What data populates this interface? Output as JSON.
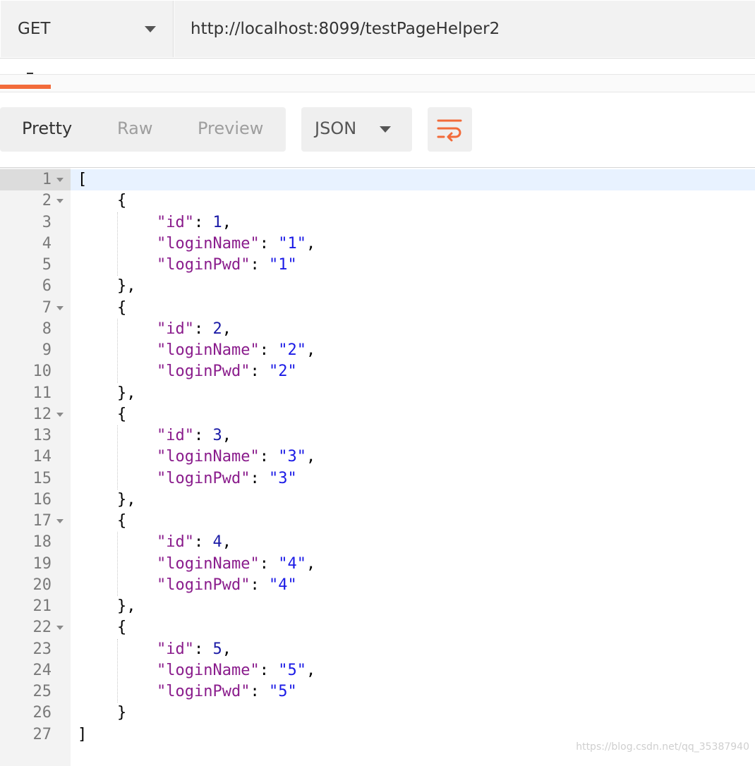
{
  "request": {
    "method": "GET",
    "url": "http://localhost:8099/testPageHelper2"
  },
  "response_toolbar": {
    "views": [
      "Pretty",
      "Raw",
      "Preview"
    ],
    "active_view": "Pretty",
    "format": "JSON",
    "wrap_icon": "wrap-lines-icon"
  },
  "code_lines": [
    {
      "n": "1",
      "fold": true,
      "indent": 0,
      "tokens": [
        {
          "t": "punc",
          "v": "["
        }
      ]
    },
    {
      "n": "2",
      "fold": true,
      "indent": 1,
      "tokens": [
        {
          "t": "punc",
          "v": "{"
        }
      ]
    },
    {
      "n": "3",
      "fold": false,
      "indent": 2,
      "tokens": [
        {
          "t": "key",
          "v": "\"id\""
        },
        {
          "t": "punc",
          "v": ": "
        },
        {
          "t": "num",
          "v": "1"
        },
        {
          "t": "punc",
          "v": ","
        }
      ]
    },
    {
      "n": "4",
      "fold": false,
      "indent": 2,
      "tokens": [
        {
          "t": "key",
          "v": "\"loginName\""
        },
        {
          "t": "punc",
          "v": ": "
        },
        {
          "t": "str",
          "v": "\"1\""
        },
        {
          "t": "punc",
          "v": ","
        }
      ]
    },
    {
      "n": "5",
      "fold": false,
      "indent": 2,
      "tokens": [
        {
          "t": "key",
          "v": "\"loginPwd\""
        },
        {
          "t": "punc",
          "v": ": "
        },
        {
          "t": "str",
          "v": "\"1\""
        }
      ]
    },
    {
      "n": "6",
      "fold": false,
      "indent": 1,
      "tokens": [
        {
          "t": "punc",
          "v": "},"
        }
      ]
    },
    {
      "n": "7",
      "fold": true,
      "indent": 1,
      "tokens": [
        {
          "t": "punc",
          "v": "{"
        }
      ]
    },
    {
      "n": "8",
      "fold": false,
      "indent": 2,
      "tokens": [
        {
          "t": "key",
          "v": "\"id\""
        },
        {
          "t": "punc",
          "v": ": "
        },
        {
          "t": "num",
          "v": "2"
        },
        {
          "t": "punc",
          "v": ","
        }
      ]
    },
    {
      "n": "9",
      "fold": false,
      "indent": 2,
      "tokens": [
        {
          "t": "key",
          "v": "\"loginName\""
        },
        {
          "t": "punc",
          "v": ": "
        },
        {
          "t": "str",
          "v": "\"2\""
        },
        {
          "t": "punc",
          "v": ","
        }
      ]
    },
    {
      "n": "10",
      "fold": false,
      "indent": 2,
      "tokens": [
        {
          "t": "key",
          "v": "\"loginPwd\""
        },
        {
          "t": "punc",
          "v": ": "
        },
        {
          "t": "str",
          "v": "\"2\""
        }
      ]
    },
    {
      "n": "11",
      "fold": false,
      "indent": 1,
      "tokens": [
        {
          "t": "punc",
          "v": "},"
        }
      ]
    },
    {
      "n": "12",
      "fold": true,
      "indent": 1,
      "tokens": [
        {
          "t": "punc",
          "v": "{"
        }
      ]
    },
    {
      "n": "13",
      "fold": false,
      "indent": 2,
      "tokens": [
        {
          "t": "key",
          "v": "\"id\""
        },
        {
          "t": "punc",
          "v": ": "
        },
        {
          "t": "num",
          "v": "3"
        },
        {
          "t": "punc",
          "v": ","
        }
      ]
    },
    {
      "n": "14",
      "fold": false,
      "indent": 2,
      "tokens": [
        {
          "t": "key",
          "v": "\"loginName\""
        },
        {
          "t": "punc",
          "v": ": "
        },
        {
          "t": "str",
          "v": "\"3\""
        },
        {
          "t": "punc",
          "v": ","
        }
      ]
    },
    {
      "n": "15",
      "fold": false,
      "indent": 2,
      "tokens": [
        {
          "t": "key",
          "v": "\"loginPwd\""
        },
        {
          "t": "punc",
          "v": ": "
        },
        {
          "t": "str",
          "v": "\"3\""
        }
      ]
    },
    {
      "n": "16",
      "fold": false,
      "indent": 1,
      "tokens": [
        {
          "t": "punc",
          "v": "},"
        }
      ]
    },
    {
      "n": "17",
      "fold": true,
      "indent": 1,
      "tokens": [
        {
          "t": "punc",
          "v": "{"
        }
      ]
    },
    {
      "n": "18",
      "fold": false,
      "indent": 2,
      "tokens": [
        {
          "t": "key",
          "v": "\"id\""
        },
        {
          "t": "punc",
          "v": ": "
        },
        {
          "t": "num",
          "v": "4"
        },
        {
          "t": "punc",
          "v": ","
        }
      ]
    },
    {
      "n": "19",
      "fold": false,
      "indent": 2,
      "tokens": [
        {
          "t": "key",
          "v": "\"loginName\""
        },
        {
          "t": "punc",
          "v": ": "
        },
        {
          "t": "str",
          "v": "\"4\""
        },
        {
          "t": "punc",
          "v": ","
        }
      ]
    },
    {
      "n": "20",
      "fold": false,
      "indent": 2,
      "tokens": [
        {
          "t": "key",
          "v": "\"loginPwd\""
        },
        {
          "t": "punc",
          "v": ": "
        },
        {
          "t": "str",
          "v": "\"4\""
        }
      ]
    },
    {
      "n": "21",
      "fold": false,
      "indent": 1,
      "tokens": [
        {
          "t": "punc",
          "v": "},"
        }
      ]
    },
    {
      "n": "22",
      "fold": true,
      "indent": 1,
      "tokens": [
        {
          "t": "punc",
          "v": "{"
        }
      ]
    },
    {
      "n": "23",
      "fold": false,
      "indent": 2,
      "tokens": [
        {
          "t": "key",
          "v": "\"id\""
        },
        {
          "t": "punc",
          "v": ": "
        },
        {
          "t": "num",
          "v": "5"
        },
        {
          "t": "punc",
          "v": ","
        }
      ]
    },
    {
      "n": "24",
      "fold": false,
      "indent": 2,
      "tokens": [
        {
          "t": "key",
          "v": "\"loginName\""
        },
        {
          "t": "punc",
          "v": ": "
        },
        {
          "t": "str",
          "v": "\"5\""
        },
        {
          "t": "punc",
          "v": ","
        }
      ]
    },
    {
      "n": "25",
      "fold": false,
      "indent": 2,
      "tokens": [
        {
          "t": "key",
          "v": "\"loginPwd\""
        },
        {
          "t": "punc",
          "v": ": "
        },
        {
          "t": "str",
          "v": "\"5\""
        }
      ]
    },
    {
      "n": "26",
      "fold": false,
      "indent": 1,
      "tokens": [
        {
          "t": "punc",
          "v": "}"
        }
      ]
    },
    {
      "n": "27",
      "fold": false,
      "indent": 0,
      "tokens": [
        {
          "t": "punc",
          "v": "]"
        }
      ]
    }
  ],
  "watermark": "https://blog.csdn.net/qq_35387940",
  "colors": {
    "accent": "#f26b3a",
    "json_key": "#8a1c8c",
    "json_string": "#1a1ae6",
    "json_number": "#1a1aa6"
  }
}
